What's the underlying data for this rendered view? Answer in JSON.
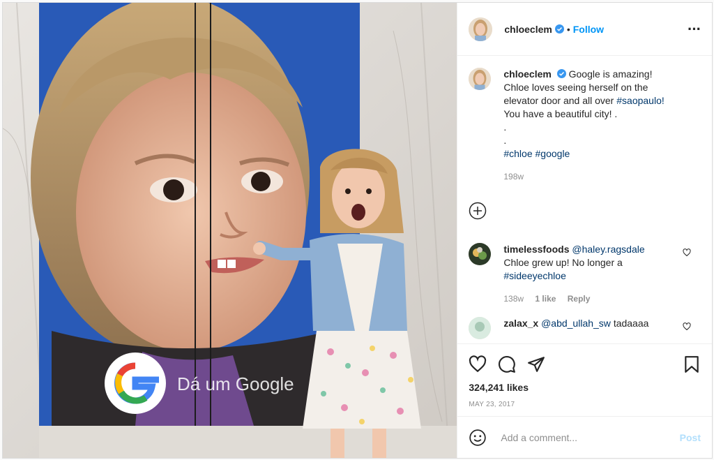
{
  "post": {
    "username": "chloeclem",
    "follow_label": "Follow",
    "caption_lines": [
      "Google is amazing!",
      "Chloe loves seeing herself on the",
      "elevator door and all over",
      "You have a beautiful city! .",
      ".",
      "."
    ],
    "caption_tag_inline": "#saopaulo!",
    "caption_tags": [
      "#chloe",
      "#google"
    ],
    "caption_time": "198w",
    "likes_text": "324,241 likes",
    "date_text": "MAY 23, 2017"
  },
  "photo": {
    "elevator_text": "Dá um Google"
  },
  "comments": [
    {
      "username": "timelessfoods",
      "mention": "@haley.ragsdale",
      "text_line1": "Chloe grew up! No longer a",
      "tag": "#sideeyechloe",
      "time": "138w",
      "likes": "1 like",
      "reply_label": "Reply"
    },
    {
      "username": "zalax_x",
      "mention": "@abd_ullah_sw",
      "text": "tadaaaa"
    }
  ],
  "add_comment": {
    "placeholder": "Add a comment...",
    "post_label": "Post"
  },
  "colors": {
    "accent": "#0095f6",
    "verified": "#3897f0",
    "link": "#00376b",
    "muted": "#8e8e8e",
    "post_disabled": "#b2dffc"
  }
}
